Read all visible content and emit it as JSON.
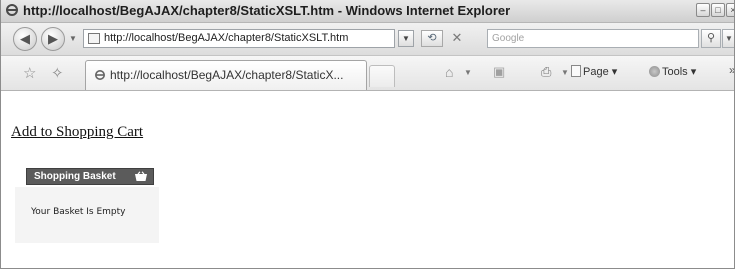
{
  "window": {
    "title": "http://localhost/BegAJAX/chapter8/StaticXSLT.htm - Windows Internet Explorer"
  },
  "address_bar": {
    "url": "http://localhost/BegAJAX/chapter8/StaticXSLT.htm",
    "search_placeholder": "Google"
  },
  "command_bar": {
    "tab_title": "http://localhost/BegAJAX/chapter8/StaticX...",
    "page_label": "Page",
    "tools_label": "Tools"
  },
  "content": {
    "add_to_cart_link": "Add to Shopping Cart",
    "basket_header": "Shopping Basket",
    "basket_empty_message": "Your Basket Is Empty"
  }
}
